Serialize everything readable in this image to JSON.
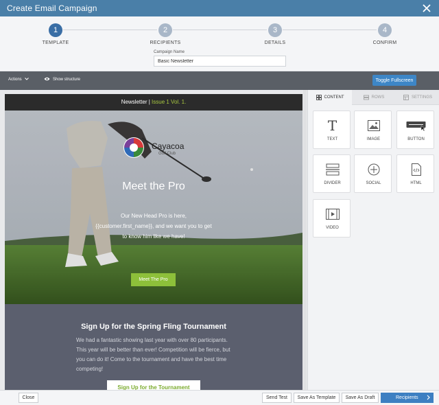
{
  "window": {
    "title": "Create Email Campaign"
  },
  "steps": [
    {
      "number": "1",
      "label": "TEMPLATE"
    },
    {
      "number": "2",
      "label": "RECIPIENTS"
    },
    {
      "number": "3",
      "label": "DETAILS"
    },
    {
      "number": "4",
      "label": "CONFIRM"
    }
  ],
  "campaign": {
    "label": "Campaign Name",
    "value": "Basic Newsletter"
  },
  "toolbar": {
    "actions": "Actions",
    "show_structure": "Show structure",
    "fullscreen": "Toggle Fullscreen"
  },
  "email": {
    "header_prefix": "Newsletter |",
    "header_issue": "Issue 1 Vol. 1.",
    "logo_brand": "Cayacoa",
    "logo_sub": "Golf Club",
    "hero_title": "Meet the Pro",
    "hero_copy": "Our New Head Pro is here, {{customer.first_name}}, and we want you to get to know him like we have!",
    "hero_button": "Meet The Pro",
    "signup_title": "Sign Up for the Spring Fling Tournament",
    "signup_copy": "We had a fantastic showing last year with over 80 participants. This year will be better than ever! Competition will be fierce, but you can do it! Come to the tournament and have the best time competing!",
    "signup_button": "Sign Up for the Tournament"
  },
  "panel": {
    "tabs": [
      "CONTENT",
      "ROWS",
      "SETTINGS"
    ],
    "tiles": [
      "TEXT",
      "IMAGE",
      "BUTTON",
      "DIVIDER",
      "SOCIAL",
      "HTML",
      "VIDEO"
    ],
    "text_glyph": "T"
  },
  "footer": {
    "close": "Close",
    "send_test": "Send Test",
    "save_template": "Save As Template",
    "save_draft": "Save As Draft",
    "next": "Recipients"
  },
  "colors": {
    "titlebar": "#4a7fa8",
    "accent_green": "#8dc03a",
    "primary_blue": "#3d7fc2"
  }
}
